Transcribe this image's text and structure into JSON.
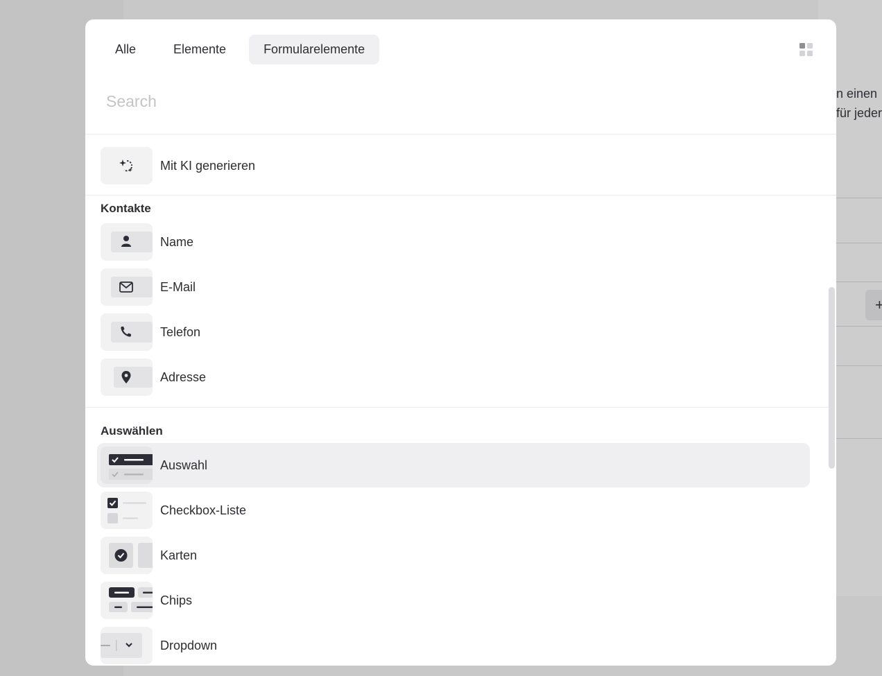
{
  "background": {
    "text_line_1": "n einen",
    "text_line_2": "für jeder",
    "plus_symbol": "+"
  },
  "tabs": [
    {
      "label": "Alle",
      "active": false
    },
    {
      "label": "Elemente",
      "active": false
    },
    {
      "label": "Formularelemente",
      "active": true
    }
  ],
  "view_toggle_icon": "grid-view-icon",
  "search": {
    "placeholder": "Search",
    "value": ""
  },
  "ai_item": {
    "label": "Mit KI generieren",
    "icon": "sparkle-icon"
  },
  "sections": [
    {
      "title": "Kontakte",
      "items": [
        {
          "label": "Name",
          "icon": "person-icon"
        },
        {
          "label": "E-Mail",
          "icon": "mail-icon"
        },
        {
          "label": "Telefon",
          "icon": "phone-icon"
        },
        {
          "label": "Adresse",
          "icon": "location-pin-icon"
        }
      ]
    },
    {
      "title": "Auswählen",
      "items": [
        {
          "label": "Auswahl",
          "icon": "choice-list-icon",
          "selected": true
        },
        {
          "label": "Checkbox-Liste",
          "icon": "checkbox-list-icon"
        },
        {
          "label": "Karten",
          "icon": "cards-icon"
        },
        {
          "label": "Chips",
          "icon": "chips-icon"
        },
        {
          "label": "Dropdown",
          "icon": "dropdown-icon"
        }
      ]
    }
  ],
  "colors": {
    "accent_dark": "#2d2d38",
    "thumb_bg": "#f2f2f3",
    "selected_bg": "#efeff1"
  }
}
